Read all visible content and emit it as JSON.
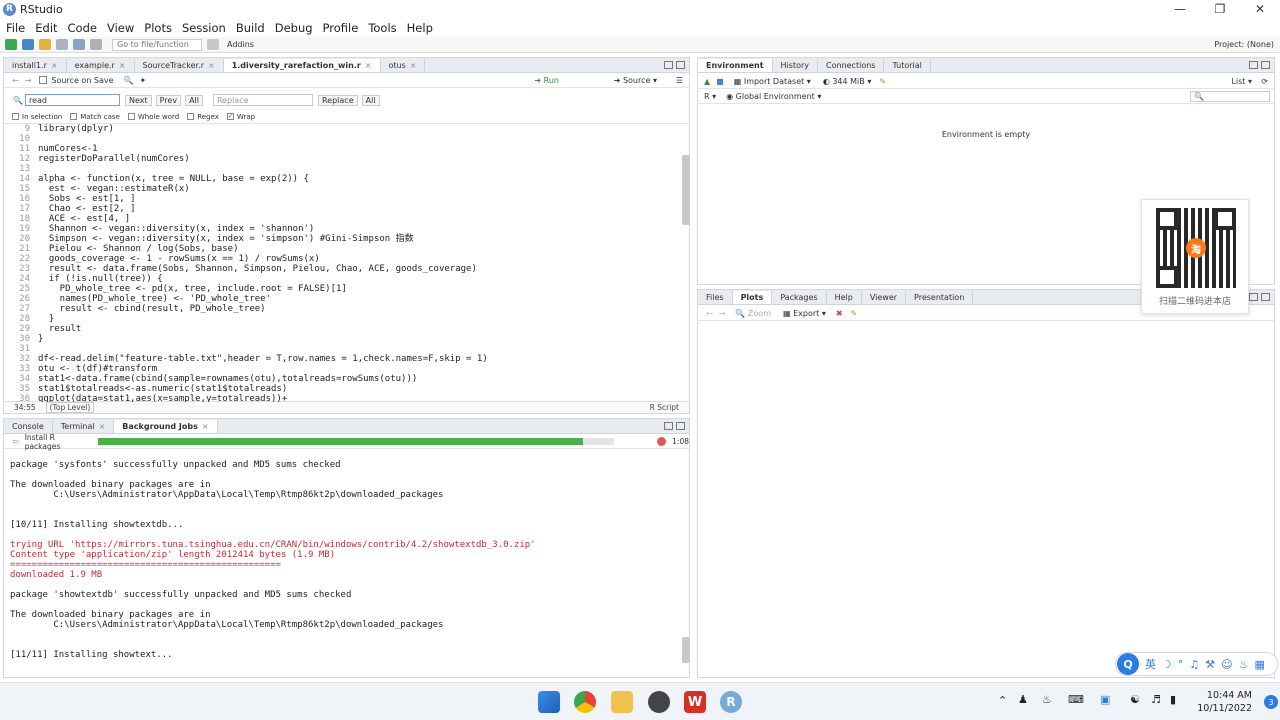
{
  "window": {
    "title": "RStudio",
    "app_icon_letter": "R"
  },
  "menu": [
    "File",
    "Edit",
    "Code",
    "View",
    "Plots",
    "Session",
    "Build",
    "Debug",
    "Profile",
    "Tools",
    "Help"
  ],
  "toolbar": {
    "goto_placeholder": "Go to file/function",
    "addins": "Addins",
    "project": "Project: (None)"
  },
  "source": {
    "tabs": [
      "install1.r",
      "example.r",
      "SourceTracker.r",
      "1.diversity_rarefaction_win.r",
      "otus"
    ],
    "source_on_save": "Source on Save",
    "run": "Run",
    "source_btn": "Source",
    "find": {
      "value": "read",
      "next": "Next",
      "prev": "Prev",
      "all": "All",
      "replace_placeholder": "Replace",
      "replace": "Replace",
      "replace_all": "All"
    },
    "options": [
      "In selection",
      "Match case",
      "Whole word",
      "Regex",
      "Wrap"
    ],
    "status_pos": "34:55",
    "status_level": "(Top Level)",
    "status_type": "R Script",
    "lines": [
      {
        "n": "9",
        "t": "library(dplyr)"
      },
      {
        "n": "10",
        "t": ""
      },
      {
        "n": "11",
        "t": "numCores<-1"
      },
      {
        "n": "12",
        "t": "registerDoParallel(numCores)"
      },
      {
        "n": "13",
        "t": ""
      },
      {
        "n": "14",
        "t": "alpha <- function(x, tree = NULL, base = exp(2)) {"
      },
      {
        "n": "15",
        "t": "  est <- vegan::estimateR(x)"
      },
      {
        "n": "16",
        "t": "  Sobs <- est[1, ]"
      },
      {
        "n": "17",
        "t": "  Chao <- est[2, ]"
      },
      {
        "n": "18",
        "t": "  ACE <- est[4, ]"
      },
      {
        "n": "19",
        "t": "  Shannon <- vegan::diversity(x, index = 'shannon')"
      },
      {
        "n": "20",
        "t": "  Simpson <- vegan::diversity(x, index = 'simpson') #Gini-Simpson 指数"
      },
      {
        "n": "21",
        "t": "  Pielou <- Shannon / log(Sobs, base)"
      },
      {
        "n": "22",
        "t": "  goods_coverage <- 1 - rowSums(x == 1) / rowSums(x)"
      },
      {
        "n": "23",
        "t": "  result <- data.frame(Sobs, Shannon, Simpson, Pielou, Chao, ACE, goods_coverage)"
      },
      {
        "n": "24",
        "t": "  if (!is.null(tree)) {"
      },
      {
        "n": "25",
        "t": "    PD_whole_tree <- pd(x, tree, include.root = FALSE)[1]"
      },
      {
        "n": "26",
        "t": "    names(PD_whole_tree) <- 'PD_whole_tree'"
      },
      {
        "n": "27",
        "t": "    result <- cbind(result, PD_whole_tree)"
      },
      {
        "n": "28",
        "t": "  }"
      },
      {
        "n": "29",
        "t": "  result"
      },
      {
        "n": "30",
        "t": "}"
      },
      {
        "n": "31",
        "t": ""
      },
      {
        "n": "32",
        "t": "df<-read.delim(\"feature-table.txt\",header = T,row.names = 1,check.names=F,skip = 1)"
      },
      {
        "n": "33",
        "t": "otu <- t(df)#transform"
      },
      {
        "n": "34",
        "t": "stat1<-data.frame(cbind(sample=rownames(otu),totalreads=rowSums(otu)))"
      },
      {
        "n": "35",
        "t": "stat1$totalreads<-as.numeric(stat1$totalreads)"
      },
      {
        "n": "36",
        "t": "ggplot(data=stat1,aes(x=sample,y=totalreads))+"
      }
    ]
  },
  "console": {
    "tabs": [
      "Console",
      "Terminal",
      "Background Jobs"
    ],
    "job_name": "Install R packages",
    "job_progress": 0.94,
    "job_time": "1:08",
    "lines": [
      {
        "t": "package 'sysfonts' successfully unpacked and MD5 sums checked",
        "c": "#222"
      },
      {
        "t": "",
        "c": "#222"
      },
      {
        "t": "The downloaded binary packages are in",
        "c": "#222"
      },
      {
        "t": "        C:\\Users\\Administrator\\AppData\\Local\\Temp\\Rtmp86kt2p\\downloaded_packages",
        "c": "#222"
      },
      {
        "t": "",
        "c": "#222"
      },
      {
        "t": "",
        "c": "#222"
      },
      {
        "t": "[10/11] Installing showtextdb...",
        "c": "#222"
      },
      {
        "t": "",
        "c": "#222"
      },
      {
        "t": "trying URL 'https://mirrors.tuna.tsinghua.edu.cn/CRAN/bin/windows/contrib/4.2/showtextdb_3.0.zip'",
        "c": "#c03030"
      },
      {
        "t": "Content type 'application/zip' length 2012414 bytes (1.9 MB)",
        "c": "#c03030"
      },
      {
        "t": "==================================================",
        "c": "#c03030"
      },
      {
        "t": "downloaded 1.9 MB",
        "c": "#c03030"
      },
      {
        "t": "",
        "c": "#222"
      },
      {
        "t": "package 'showtextdb' successfully unpacked and MD5 sums checked",
        "c": "#222"
      },
      {
        "t": "",
        "c": "#222"
      },
      {
        "t": "The downloaded binary packages are in",
        "c": "#222"
      },
      {
        "t": "        C:\\Users\\Administrator\\AppData\\Local\\Temp\\Rtmp86kt2p\\downloaded_packages",
        "c": "#222"
      },
      {
        "t": "",
        "c": "#222"
      },
      {
        "t": "",
        "c": "#222"
      },
      {
        "t": "[11/11] Installing showtext...",
        "c": "#222"
      }
    ]
  },
  "environment": {
    "tabs": [
      "Environment",
      "History",
      "Connections",
      "Tutorial"
    ],
    "import_dataset": "Import Dataset",
    "memory": "344 MiB",
    "list_label": "List",
    "r_label": "R",
    "global_env": "Global Environment",
    "empty_msg": "Environment is empty"
  },
  "files": {
    "tabs": [
      "Files",
      "Plots",
      "Packages",
      "Help",
      "Viewer",
      "Presentation"
    ],
    "zoom": "Zoom",
    "export": "Export"
  },
  "qr_overlay": {
    "caption": "扫描二维码进本店",
    "center": "淘"
  },
  "ime": {
    "lang": "英"
  },
  "taskbar": {
    "time": "10:44 AM",
    "date": "10/11/2022",
    "badge": "3"
  },
  "colors": {
    "progress": "#4cb04a",
    "tab_bg": "#e8ecf0",
    "accent": "#2c7be5"
  }
}
